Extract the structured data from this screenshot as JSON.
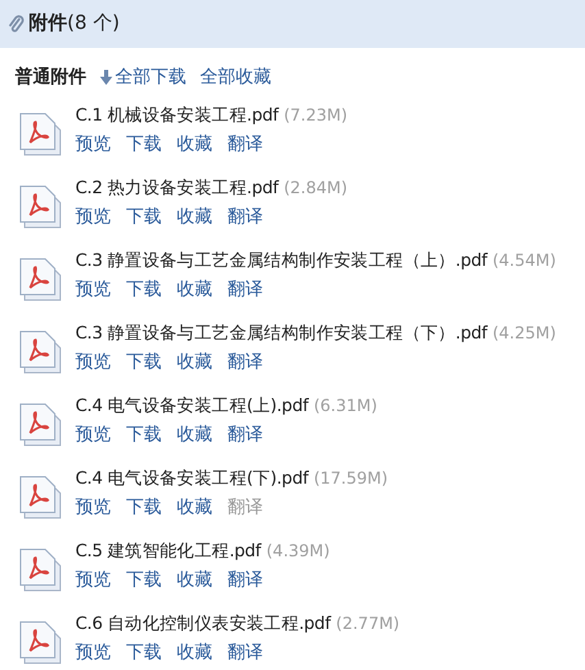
{
  "header": {
    "title": "附件",
    "count": "(8 个)"
  },
  "toolbar": {
    "label": "普通附件",
    "download_all": "全部下载",
    "collect_all": "全部收藏"
  },
  "files": [
    {
      "name": "C.1 机械设备安装工程.pdf",
      "size": "(7.23M)",
      "actions": [
        {
          "label": "预览",
          "disabled": false
        },
        {
          "label": "下载",
          "disabled": false
        },
        {
          "label": "收藏",
          "disabled": false
        },
        {
          "label": "翻译",
          "disabled": false
        }
      ]
    },
    {
      "name": "C.2 热力设备安装工程.pdf",
      "size": "(2.84M)",
      "actions": [
        {
          "label": "预览",
          "disabled": false
        },
        {
          "label": "下载",
          "disabled": false
        },
        {
          "label": "收藏",
          "disabled": false
        },
        {
          "label": "翻译",
          "disabled": false
        }
      ]
    },
    {
      "name": "C.3 静置设备与工艺金属结构制作安装工程（上）.pdf",
      "size": "(4.54M)",
      "actions": [
        {
          "label": "预览",
          "disabled": false
        },
        {
          "label": "下载",
          "disabled": false
        },
        {
          "label": "收藏",
          "disabled": false
        },
        {
          "label": "翻译",
          "disabled": false
        }
      ]
    },
    {
      "name": "C.3 静置设备与工艺金属结构制作安装工程（下）.pdf",
      "size": "(4.25M)",
      "actions": [
        {
          "label": "预览",
          "disabled": false
        },
        {
          "label": "下载",
          "disabled": false
        },
        {
          "label": "收藏",
          "disabled": false
        },
        {
          "label": "翻译",
          "disabled": false
        }
      ]
    },
    {
      "name": "C.4 电气设备安装工程(上).pdf",
      "size": "(6.31M)",
      "actions": [
        {
          "label": "预览",
          "disabled": false
        },
        {
          "label": "下载",
          "disabled": false
        },
        {
          "label": "收藏",
          "disabled": false
        },
        {
          "label": "翻译",
          "disabled": false
        }
      ]
    },
    {
      "name": "C.4 电气设备安装工程(下).pdf",
      "size": "(17.59M)",
      "actions": [
        {
          "label": "预览",
          "disabled": false
        },
        {
          "label": "下载",
          "disabled": false
        },
        {
          "label": "收藏",
          "disabled": false
        },
        {
          "label": "翻译",
          "disabled": true
        }
      ]
    },
    {
      "name": "C.5 建筑智能化工程.pdf",
      "size": "(4.39M)",
      "actions": [
        {
          "label": "预览",
          "disabled": false
        },
        {
          "label": "下载",
          "disabled": false
        },
        {
          "label": "收藏",
          "disabled": false
        },
        {
          "label": "翻译",
          "disabled": false
        }
      ]
    },
    {
      "name": "C.6 自动化控制仪表安装工程.pdf",
      "size": "(2.77M)",
      "actions": [
        {
          "label": "预览",
          "disabled": false
        },
        {
          "label": "下载",
          "disabled": false
        },
        {
          "label": "收藏",
          "disabled": false
        },
        {
          "label": "翻译",
          "disabled": false
        }
      ]
    }
  ]
}
